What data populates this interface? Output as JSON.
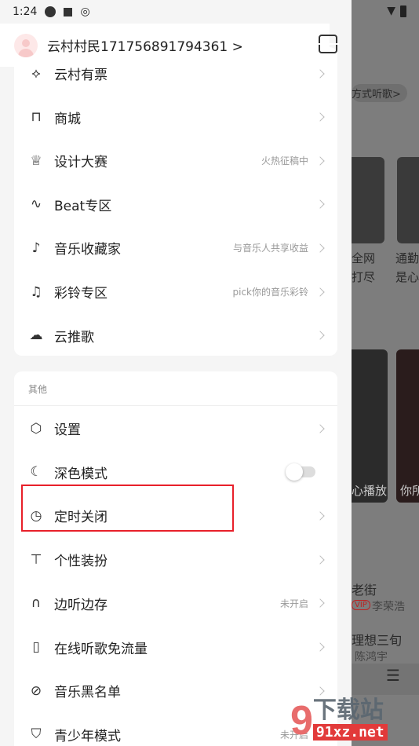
{
  "status_bar": {
    "time": "1:24",
    "icons": [
      "notification-icon",
      "a-icon",
      "netease-icon"
    ],
    "right_icons": [
      "wifi-icon",
      "battery-icon"
    ]
  },
  "header": {
    "username": "云村村民171756891794361 >",
    "scan_icon": "scan-icon"
  },
  "card1": {
    "items": [
      {
        "label": "云村有票",
        "icon": "ticket-icon",
        "sub": ""
      },
      {
        "label": "商城",
        "icon": "bag-icon",
        "sub": ""
      },
      {
        "label": "设计大赛",
        "icon": "trophy-icon",
        "sub": "火热征稿中"
      },
      {
        "label": "Beat专区",
        "icon": "beat-icon",
        "sub": ""
      },
      {
        "label": "音乐收藏家",
        "icon": "collector-icon",
        "sub": "与音乐人共享收益"
      },
      {
        "label": "彩铃专区",
        "icon": "ringtone-icon",
        "sub": "pick你的音乐彩铃"
      },
      {
        "label": "云推歌",
        "icon": "cloud-icon",
        "sub": ""
      }
    ]
  },
  "card2": {
    "title": "其他",
    "items": [
      {
        "label": "设置",
        "icon": "settings-icon",
        "sub": ""
      },
      {
        "label": "深色模式",
        "icon": "moon-icon",
        "sub": "",
        "toggle": false
      },
      {
        "label": "定时关闭",
        "icon": "timer-icon",
        "sub": ""
      },
      {
        "label": "个性装扮",
        "icon": "shirt-icon",
        "sub": ""
      },
      {
        "label": "边听边存",
        "icon": "headphone-icon",
        "sub": "未开启"
      },
      {
        "label": "在线听歌免流量",
        "icon": "simcard-icon",
        "sub": ""
      },
      {
        "label": "音乐黑名单",
        "icon": "block-icon",
        "sub": ""
      },
      {
        "label": "青少年模式",
        "icon": "shield-icon",
        "sub": "未开启"
      }
    ]
  },
  "background": {
    "chip": "方式听歌>",
    "t1": "全网",
    "t2": "打尽",
    "t3": "通勤",
    "t4": "是心",
    "t5": "心播放",
    "t6": "你所",
    "song1": "老街",
    "badge": "VIP",
    "artist1": "李荣浩",
    "song2": "理想三旬",
    "artist2": "陈鸿宇"
  },
  "watermark": {
    "text": "91下载站",
    "url": "91xz.net"
  },
  "highlight_color": "#e8202a"
}
